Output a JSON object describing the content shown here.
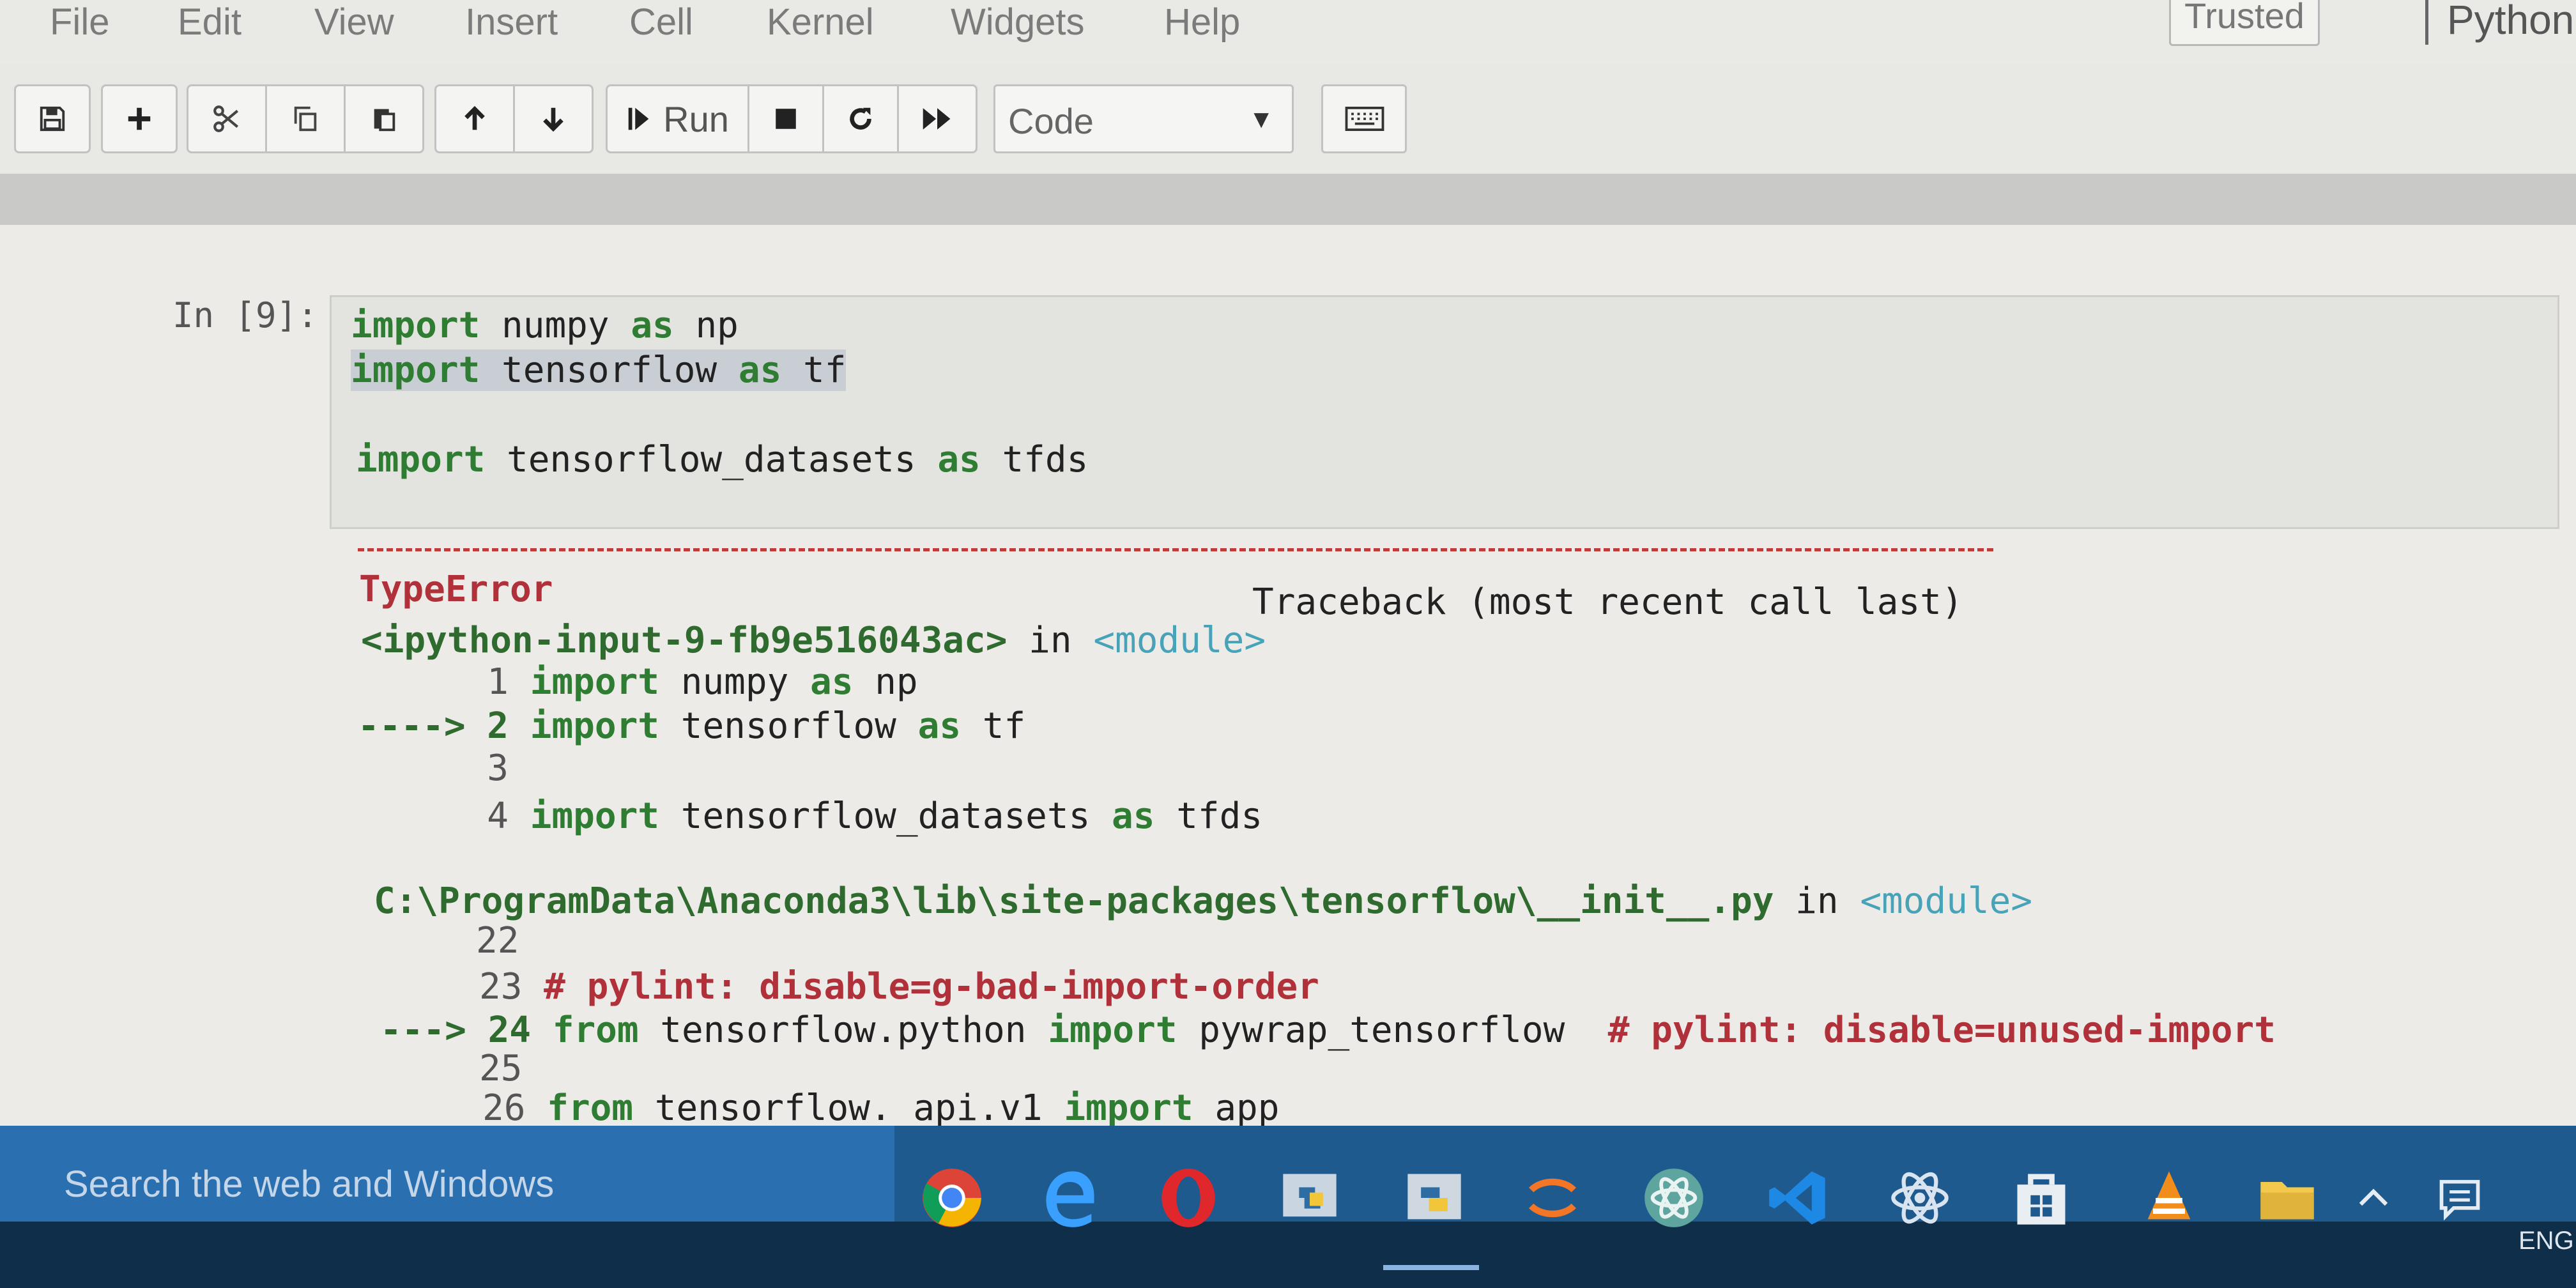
{
  "menubar": {
    "items": [
      "File",
      "Edit",
      "View",
      "Insert",
      "Cell",
      "Kernel",
      "Widgets",
      "Help"
    ],
    "trusted_label": "Trusted",
    "kernel_name": "Python"
  },
  "toolbar": {
    "run_label": "Run",
    "cell_type": "Code"
  },
  "cell": {
    "prompt": "In [9]:",
    "lines": [
      {
        "kw": "import",
        "rest": " numpy ",
        "kw2": "as",
        "rest2": " np"
      },
      {
        "kw": "import",
        "rest": " tensorflow ",
        "kw2": "as",
        "rest2": " tf"
      },
      {
        "kw": "import",
        "rest": " tensorflow_datasets ",
        "kw2": "as",
        "rest2": " tfds"
      }
    ]
  },
  "traceback": {
    "error_type": "TypeError",
    "header_right": "Traceback (most recent call last)",
    "frame1": {
      "source": "<ipython-input-9-fb9e516043ac>",
      "in_word": " in ",
      "module": "<module>",
      "lines": [
        {
          "marker": "      ",
          "num": "1",
          "kw": "import",
          "rest": " numpy ",
          "kw2": "as",
          "rest2": " np"
        },
        {
          "marker": "----> ",
          "num": "2",
          "kw": "import",
          "rest": " tensorflow ",
          "kw2": "as",
          "rest2": " tf"
        },
        {
          "marker": "      ",
          "num": "3",
          "kw": "",
          "rest": "",
          "kw2": "",
          "rest2": ""
        },
        {
          "marker": "      ",
          "num": "4",
          "kw": "import",
          "rest": " tensorflow_datasets ",
          "kw2": "as",
          "rest2": " tfds"
        }
      ]
    },
    "frame2": {
      "source": "C:\\ProgramData\\Anaconda3\\lib\\site-packages\\tensorflow\\__init__.py",
      "in_word": " in ",
      "module": "<module>",
      "line22": "22",
      "line23_num": "23",
      "line23_comment": "# pylint: disable=g-bad-import-order",
      "line24_marker": "---> ",
      "line24_num": "24",
      "line24_from": "from",
      "line24_mod": " tensorflow.python ",
      "line24_import": "import",
      "line24_name": " pywrap_tensorflow  ",
      "line24_comment": "# pylint: disable=unused-import",
      "line25": "25",
      "line26_num": "26",
      "line26_from": "from",
      "line26_mod": " tensorflow._api.v1 ",
      "line26_import": "import",
      "line26_name": " app"
    }
  },
  "taskbar": {
    "search_placeholder": "Search the web and Windows",
    "language": "ENG"
  }
}
